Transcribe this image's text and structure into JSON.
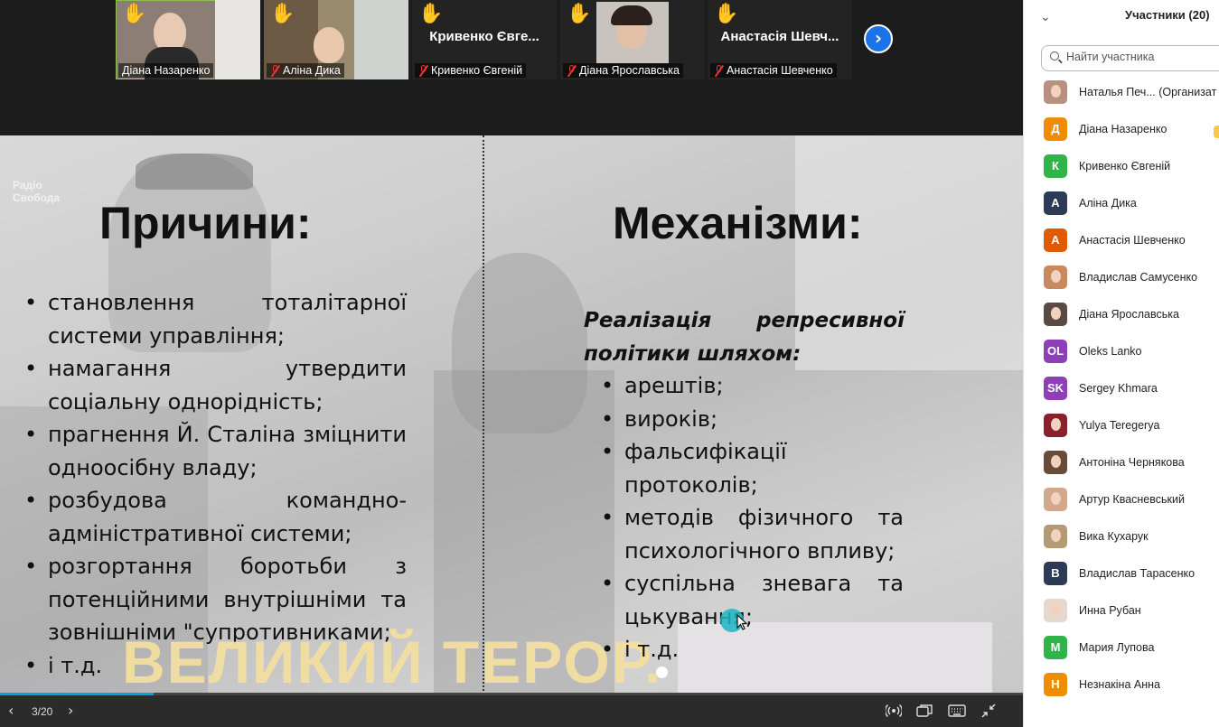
{
  "video_strip": {
    "tiles": [
      {
        "name": "Діана Назаренко",
        "label": "Діана Назаренко",
        "hand": "✋",
        "muted": false,
        "video": true
      },
      {
        "name": "Аліна Дика",
        "label": "Аліна Дика",
        "hand": "✋",
        "muted": true,
        "video": true
      },
      {
        "name": "Кривенко Євге...",
        "label": "Кривенко Євгеній",
        "hand": "✋",
        "muted": true,
        "video": false
      },
      {
        "name": "Діана Ярославська",
        "label": "Діана Ярославська",
        "hand": "✋",
        "muted": true,
        "video": true
      },
      {
        "name": "Анастасія Шевч...",
        "label": "Анастасія Шевченко",
        "hand": "✋",
        "muted": true,
        "video": false
      }
    ],
    "next_icon": "chevron-right-icon",
    "next_glyph": "›"
  },
  "slide": {
    "watermark_line1": "Радіо",
    "watermark_line2": "Свобода",
    "left_heading": "Причини:",
    "left_items": [
      "становлення тоталітарної системи управління;",
      "намагання утвердити соціальну однорідність;",
      "прагнення Й. Сталіна зміцнити одноосібну владу;",
      "розбудова командно-адміністративної системи;",
      "розгортання боротьби з потенційними внутрішніми та зовнішніми \"супротивниками;",
      "і т.д."
    ],
    "right_heading": "Механізми:",
    "right_intro": "Реалізація репресивної політики шляхом:",
    "right_items": [
      "арештів;",
      "вироків;",
      "фальсифікації протоколів;",
      "методів фізичного та психологічного впливу;",
      "суспільна зневага та цькування;",
      "і т.д."
    ],
    "banner": "ВЕЛИКИЙ ТЕРОР."
  },
  "bottom_bar": {
    "page_indicator": "3/20",
    "progress": 0.15,
    "prev_icon": "chevron-left-icon",
    "next_icon": "chevron-right-icon",
    "prev_glyph": "‹",
    "next_glyph": "›"
  },
  "participants": {
    "title": "Участники (20)",
    "collapse_glyph": "⌄",
    "search_placeholder": "Найти участника",
    "list": [
      {
        "name": "Наталья Печ... (Организат",
        "initial": "",
        "color": "#b99080",
        "photo": true
      },
      {
        "name": "Діана Назаренко",
        "initial": "Д",
        "color": "#f08c00",
        "photo": false
      },
      {
        "name": "Кривенко Євгеній",
        "initial": "К",
        "color": "#2fb44a",
        "photo": false
      },
      {
        "name": "Аліна Дика",
        "initial": "А",
        "color": "#2c3a57",
        "photo": false
      },
      {
        "name": "Анастасія Шевченко",
        "initial": "А",
        "color": "#e05a00",
        "photo": false
      },
      {
        "name": "Владислав Самусенко",
        "initial": "",
        "color": "#c7895e",
        "photo": true
      },
      {
        "name": "Діана Ярославська",
        "initial": "",
        "color": "#5a4a44",
        "photo": true
      },
      {
        "name": "Oleks Lanko",
        "initial": "OL",
        "color": "#8e3fb8",
        "photo": false
      },
      {
        "name": "Sergey Khmara",
        "initial": "SK",
        "color": "#8e3fb8",
        "photo": false
      },
      {
        "name": "Yulya Teregerya",
        "initial": "",
        "color": "#8a1f2e",
        "photo": true
      },
      {
        "name": "Антоніна Чернякова",
        "initial": "",
        "color": "#6a4a3a",
        "photo": true
      },
      {
        "name": "Артур Квасневський",
        "initial": "",
        "color": "#d3a88a",
        "photo": true
      },
      {
        "name": "Вика Кухарук",
        "initial": "",
        "color": "#b49a74",
        "photo": true
      },
      {
        "name": "Владислав Тарасенко",
        "initial": "В",
        "color": "#2c3a57",
        "photo": false
      },
      {
        "name": "Инна Рубан",
        "initial": "",
        "color": "#e6d8cc",
        "photo": true
      },
      {
        "name": "Мария Лупова",
        "initial": "М",
        "color": "#2fb44a",
        "photo": false
      },
      {
        "name": "Незнакіна Анна",
        "initial": "Н",
        "color": "#f08c00",
        "photo": false
      }
    ]
  }
}
